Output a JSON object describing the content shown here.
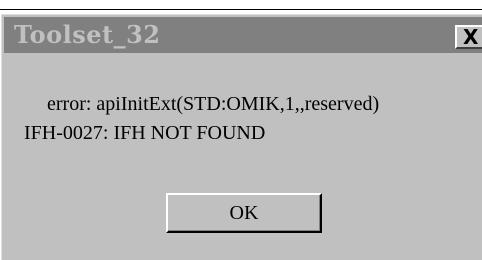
{
  "window": {
    "title": "Toolset_32",
    "close_label": "X"
  },
  "message": {
    "line1": "error:  apiInitExt(STD:OMIK,1,,reserved)",
    "line2": "IFH-0027: IFH NOT FOUND"
  },
  "buttons": {
    "ok_label": "OK"
  },
  "icons": {
    "close": "close-icon"
  },
  "colors": {
    "title_bar_inactive": "#808080",
    "title_text": "#c0c0c0",
    "dialog_face": "#c0c0c0"
  }
}
